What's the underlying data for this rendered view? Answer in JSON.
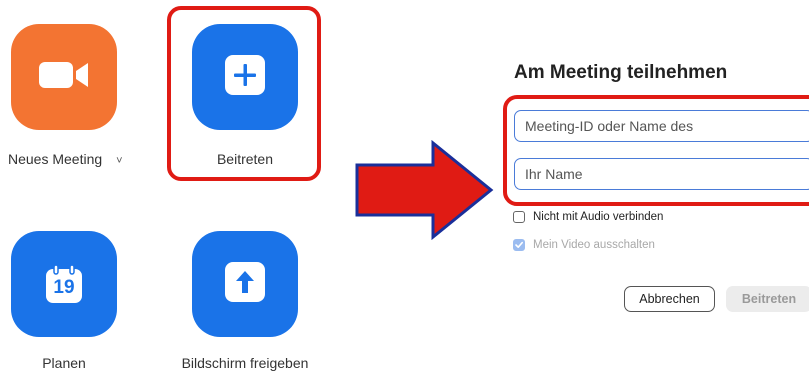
{
  "home": {
    "new_meeting": {
      "label": "Neues Meeting",
      "chevron": "˅",
      "icon": "video-camera-icon",
      "color": "#f37432"
    },
    "join": {
      "label": "Beitreten",
      "icon": "plus-icon",
      "color": "#1a73e8"
    },
    "schedule": {
      "label": "Planen",
      "icon": "calendar-icon",
      "day": "19",
      "color": "#1a73e8"
    },
    "share_screen": {
      "label": "Bildschirm freigeben",
      "icon": "arrow-up-icon",
      "color": "#1a73e8"
    }
  },
  "annotation": {
    "highlight_color": "#e01b14",
    "arrow_color": "#e01b14",
    "arrow_icon": "right-arrow-icon"
  },
  "dialog": {
    "title": "Am Meeting teilnehmen",
    "meeting_id_placeholder": "Meeting-ID oder Name des",
    "name_placeholder": "Ihr Name",
    "no_audio_label": "Nicht mit Audio verbinden",
    "no_audio_checked": false,
    "video_off_label": "Mein Video ausschalten",
    "video_off_checked": true,
    "cancel_label": "Abbrechen",
    "join_label": "Beitreten"
  }
}
